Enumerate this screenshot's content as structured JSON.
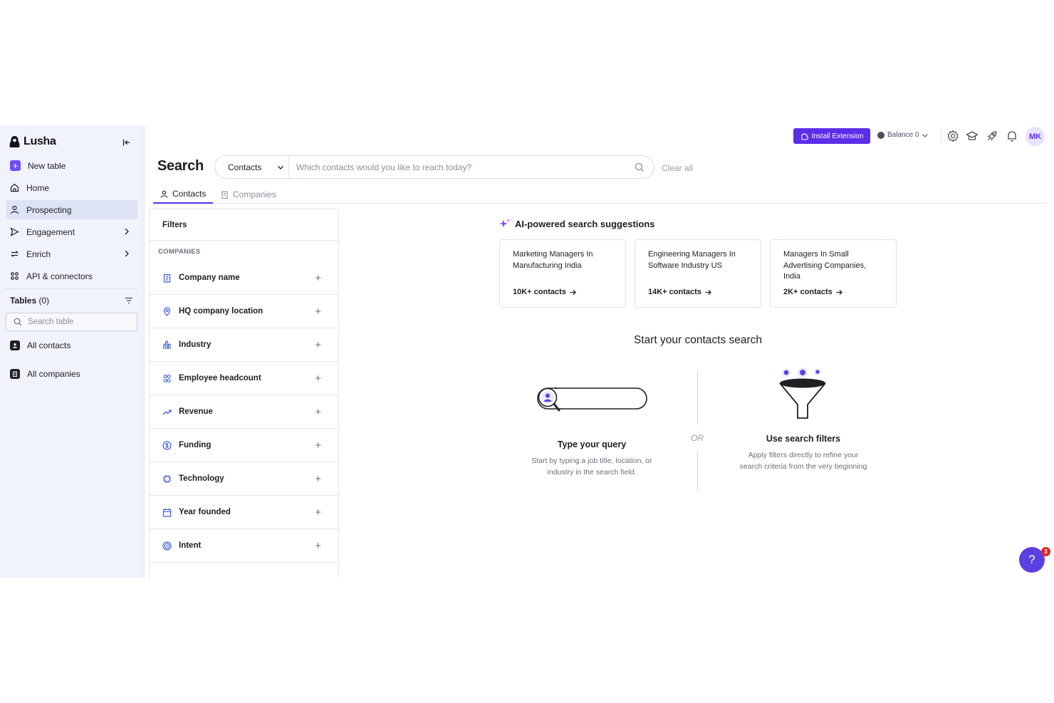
{
  "app": {
    "brand": "Lusha",
    "accent": "#5b2ee8"
  },
  "sidebar": {
    "new_table": "New table",
    "items": [
      {
        "label": "Home",
        "icon": "home-icon"
      },
      {
        "label": "Prospecting",
        "icon": "person-icon",
        "active": true
      },
      {
        "label": "Engagement",
        "icon": "send-icon"
      },
      {
        "label": "Enrich",
        "icon": "refresh-icon"
      },
      {
        "label": "API & connectors",
        "icon": "api-icon"
      }
    ],
    "tables_label": "Tables",
    "tables_count": "(0)",
    "search_placeholder": "Search table",
    "all_contacts": "All contacts",
    "all_companies": "All companies"
  },
  "header": {
    "title": "Search",
    "search_type": "Contacts",
    "search_placeholder": "Which contacts would you like to reach today?",
    "clear_all": "Clear all",
    "install_extension": "Install Extension",
    "balance": "Balance 0",
    "avatar_initials": "MK"
  },
  "tabs": [
    {
      "label": "Contacts",
      "active": true
    },
    {
      "label": "Companies",
      "active": false
    }
  ],
  "filters": {
    "title": "Filters",
    "section": "COMPANIES",
    "items": [
      {
        "label": "Company name",
        "icon": "building-icon"
      },
      {
        "label": "HQ company location",
        "icon": "location-pin-icon"
      },
      {
        "label": "Industry",
        "icon": "industry-icon"
      },
      {
        "label": "Employee headcount",
        "icon": "people-icon"
      },
      {
        "label": "Revenue",
        "icon": "trend-up-icon"
      },
      {
        "label": "Funding",
        "icon": "dollar-icon"
      },
      {
        "label": "Technology",
        "icon": "chip-icon"
      },
      {
        "label": "Year founded",
        "icon": "calendar-icon"
      },
      {
        "label": "Intent",
        "icon": "target-icon"
      }
    ]
  },
  "ai": {
    "title": "AI-powered search suggestions",
    "cards": [
      {
        "text": "Marketing Managers In Manufacturing India",
        "count": "10K+ contacts"
      },
      {
        "text": "Engineering Managers In Software Industry US",
        "count": "14K+ contacts"
      },
      {
        "text": "Managers In Small Advertising Companies, India",
        "count": "2K+ contacts"
      }
    ]
  },
  "empty_state": {
    "title": "Start your contacts search",
    "or": "OR",
    "query_title": "Type your query",
    "query_desc": "Start by typing a job title, location, or industry in the search field.",
    "filters_title": "Use search filters",
    "filters_desc": "Apply filters directly to refine your search criteria from the very beginning"
  },
  "help": {
    "label": "?",
    "badge": "3"
  }
}
